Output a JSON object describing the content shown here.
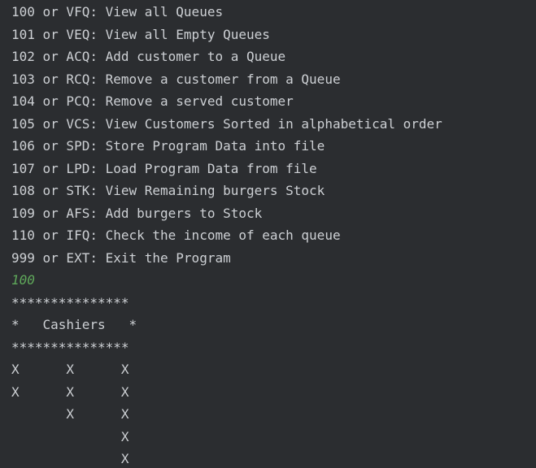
{
  "menu": [
    "100 or VFQ: View all Queues",
    "101 or VEQ: View all Empty Queues",
    "102 or ACQ: Add customer to a Queue",
    "103 or RCQ: Remove a customer from a Queue",
    "104 or PCQ: Remove a served customer",
    "105 or VCS: View Customers Sorted in alphabetical order",
    "106 or SPD: Store Program Data into file",
    "107 or LPD: Load Program Data from file",
    "108 or STK: View Remaining burgers Stock",
    "109 or AFS: Add burgers to Stock",
    "110 or IFQ: Check the income of each queue",
    "999 or EXT: Exit the Program"
  ],
  "user_input": "100",
  "output": [
    "***************",
    "*   Cashiers   *",
    "***************",
    "X      X      X",
    "X      X      X",
    "       X      X",
    "              X",
    "              X"
  ]
}
